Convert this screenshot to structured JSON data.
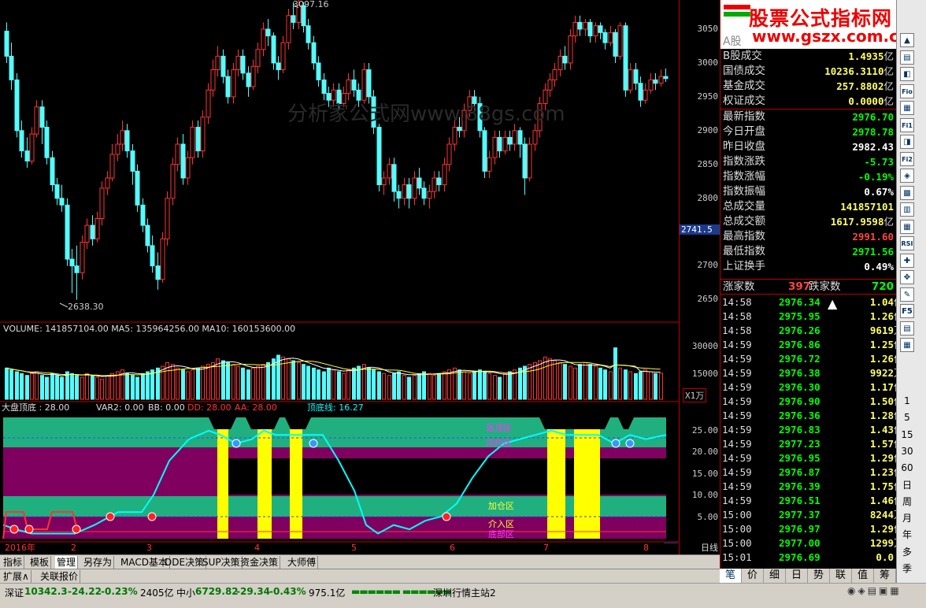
{
  "chart_data": {
    "type": "candlestick",
    "price_axis": [
      3050,
      3000,
      2950,
      2900,
      2850,
      2800,
      2741.5,
      2700,
      2650
    ],
    "high_label": "3097.16",
    "low_label": "2638.30",
    "current_tag": "2741.5",
    "watermark": "分析家公式网www.88gs.com",
    "volume_info": "VOLUME: 141857104.00  MA5: 135964256.00  MA10: 160153600.00",
    "volume_axis": [
      30000,
      15000
    ],
    "volume_unit": "X1万",
    "ind_label": "大盘顶底 : 28.00",
    "ind_var2": "VAR2: 0.00",
    "ind_bb": "BB: 0.00",
    "ind_dd": "DD: 28.00",
    "ind_aa": "AA: 28.00",
    "ind_line": "顶底线: 16.27",
    "ind_axis": [
      "25.00",
      "20.00",
      "15.00",
      "10.00",
      "5.00"
    ],
    "zones": [
      "逃顶区",
      "风险区",
      "加仓区",
      "介入区",
      "底部区"
    ],
    "months": [
      "2016年",
      "2",
      "3",
      "4",
      "5",
      "6",
      "7",
      "8"
    ],
    "period": "日线"
  },
  "logo": {
    "title": "股票公式指标网",
    "url": "www.gszx.com.cn"
  },
  "panel": {
    "header": "A股",
    "rows": [
      {
        "label": "B股成交",
        "value": "1.4935",
        "unit": "亿",
        "color": "#ffff66"
      },
      {
        "label": "国债成交",
        "value": "10236.3110",
        "unit": "亿",
        "color": "#ffff66"
      },
      {
        "label": "基金成交",
        "value": "257.8802",
        "unit": "亿",
        "color": "#ffff66"
      },
      {
        "label": "权证成交",
        "value": "0.0000",
        "unit": "亿",
        "color": "#ffff66"
      },
      {
        "label": "最新指数",
        "value": "2976.70",
        "unit": "",
        "color": "#00ff00"
      },
      {
        "label": "今日开盘",
        "value": "2978.78",
        "unit": "",
        "color": "#00ff00"
      },
      {
        "label": "昨日收盘",
        "value": "2982.43",
        "unit": "",
        "color": "#ffffff"
      },
      {
        "label": "指数涨跌",
        "value": "-5.73",
        "unit": "",
        "color": "#00ff00"
      },
      {
        "label": "指数涨幅",
        "value": "-0.19%",
        "unit": "",
        "color": "#00ff00"
      },
      {
        "label": "指数振幅",
        "value": "0.67%",
        "unit": "",
        "color": "#ffffff"
      },
      {
        "label": "总成交量",
        "value": "141857101",
        "unit": "",
        "color": "#ffff66"
      },
      {
        "label": "总成交额",
        "value": "1617.9598",
        "unit": "亿",
        "color": "#ffff66"
      },
      {
        "label": "最高指数",
        "value": "2991.60",
        "unit": "",
        "color": "#ff4444"
      },
      {
        "label": "最低指数",
        "value": "2971.56",
        "unit": "",
        "color": "#00ff00"
      },
      {
        "label": "上证换手",
        "value": "0.49%",
        "unit": "",
        "color": "#ffffff"
      }
    ],
    "rise_label": "涨家数",
    "rise_value": "397",
    "fall_label": "跌家数",
    "fall_value": "720",
    "ticks": [
      {
        "t": "14:58",
        "p": "2976.34",
        "v": "1.04",
        "u": "亿"
      },
      {
        "t": "14:58",
        "p": "2975.95",
        "v": "1.26",
        "u": "亿"
      },
      {
        "t": "14:58",
        "p": "2976.26",
        "v": "9619",
        "u": "万"
      },
      {
        "t": "14:59",
        "p": "2976.86",
        "v": "1.25",
        "u": "亿"
      },
      {
        "t": "14:59",
        "p": "2976.72",
        "v": "1.26",
        "u": "亿"
      },
      {
        "t": "14:59",
        "p": "2976.38",
        "v": "9922",
        "u": "万"
      },
      {
        "t": "14:59",
        "p": "2976.30",
        "v": "1.17",
        "u": "亿"
      },
      {
        "t": "14:59",
        "p": "2976.90",
        "v": "1.50",
        "u": "亿"
      },
      {
        "t": "14:59",
        "p": "2976.36",
        "v": "1.28",
        "u": "亿"
      },
      {
        "t": "14:59",
        "p": "2976.83",
        "v": "1.43",
        "u": "亿"
      },
      {
        "t": "14:59",
        "p": "2977.23",
        "v": "1.57",
        "u": "亿"
      },
      {
        "t": "14:59",
        "p": "2976.95",
        "v": "1.29",
        "u": "亿"
      },
      {
        "t": "14:59",
        "p": "2976.87",
        "v": "1.23",
        "u": "亿"
      },
      {
        "t": "14:59",
        "p": "2976.39",
        "v": "1.75",
        "u": "亿"
      },
      {
        "t": "14:59",
        "p": "2976.51",
        "v": "1.46",
        "u": "亿"
      },
      {
        "t": "15:00",
        "p": "2977.37",
        "v": "8244",
        "u": "万"
      },
      {
        "t": "15:00",
        "p": "2976.97",
        "v": "1.29",
        "u": "亿"
      },
      {
        "t": "15:00",
        "p": "2977.00",
        "v": "1299",
        "u": "万"
      },
      {
        "t": "15:01",
        "p": "2976.69",
        "v": "0.0",
        "u": ""
      }
    ],
    "bottom_tabs": [
      "笔",
      "价",
      "细",
      "日",
      "势",
      "联",
      "值",
      "筹"
    ]
  },
  "tabs": [
    "指标",
    "模板",
    "管理",
    "另存为",
    "MACD基本",
    "DDE决策",
    "SUP决策",
    "资金决策",
    "大师傅"
  ],
  "tabs2": [
    "扩展∧",
    "关联报价"
  ],
  "side_icons": [
    "Fio",
    "Fi1",
    "Fi2",
    "F5",
    "RSI"
  ],
  "side_nums": [
    "1",
    "5",
    "15",
    "30",
    "60",
    "日",
    "周",
    "月",
    "年",
    "多",
    "季"
  ],
  "status": {
    "sz_label": "深证",
    "sz_value": "10342.3",
    "sz_chg": "-24.22",
    "sz_pct": "-0.23%",
    "sz_amt": "2405亿",
    "zx_label": "中小",
    "zx_value": "6729.82",
    "zx_chg": "-29.34",
    "zx_pct": "-0.43%",
    "zx_amt": "975.1亿",
    "server": "深圳行情主站2"
  }
}
